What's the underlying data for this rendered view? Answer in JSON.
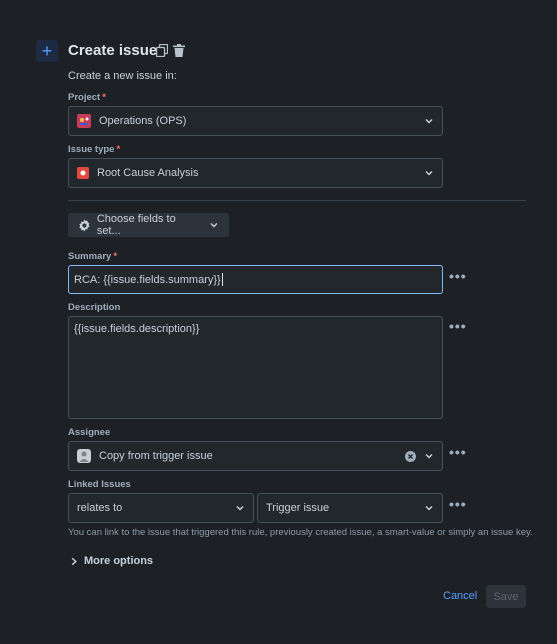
{
  "header": {
    "title": "Create issue",
    "subtitle": "Create a new issue in:"
  },
  "project": {
    "label": "Project",
    "required_mark": "*",
    "value": "Operations (OPS)"
  },
  "issue_type": {
    "label": "Issue type",
    "required_mark": "*",
    "value": "Root Cause Analysis"
  },
  "choose_fields": {
    "label": "Choose fields to set..."
  },
  "summary": {
    "label": "Summary",
    "required_mark": "*",
    "value": "RCA: {{issue.fields.summary}}"
  },
  "description": {
    "label": "Description",
    "value": "{{issue.fields.description}}"
  },
  "assignee": {
    "label": "Assignee",
    "value": "Copy from trigger issue"
  },
  "linked_issues": {
    "label": "Linked Issues",
    "relation": "relates to",
    "target": "Trigger issue",
    "hint": "You can link to the issue that triggered this rule, previously created issue, a smart-value or simply an issue key."
  },
  "more_options": {
    "label": "More options"
  },
  "footer": {
    "cancel_label": "Cancel",
    "save_label": "Save"
  },
  "colors": {
    "background": "#1d2125",
    "accent": "#579dff",
    "required": "#f87168",
    "issue_type_icon": "#e2483d"
  },
  "icons": [
    "plus-icon",
    "copy-icon",
    "trash-icon",
    "project-avatar-icon",
    "issue-type-icon",
    "gear-icon",
    "chevron-down-icon",
    "more-icon",
    "clear-icon",
    "user-avatar-icon",
    "chevron-right-icon"
  ]
}
